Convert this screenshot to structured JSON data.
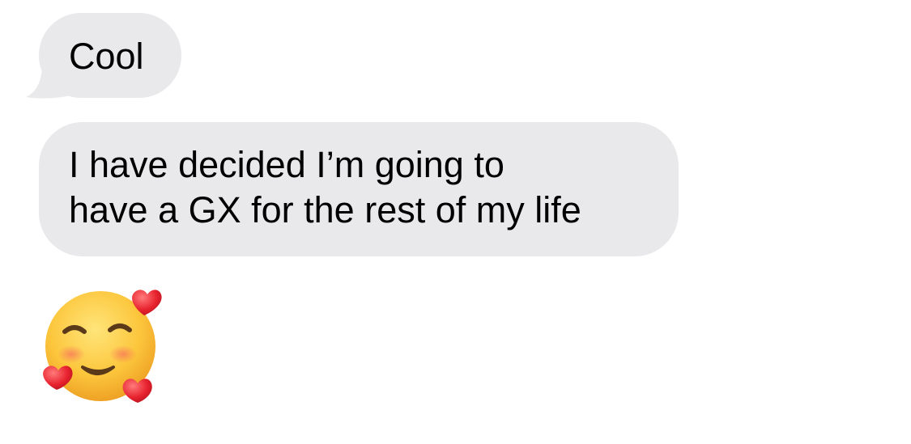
{
  "messages": [
    {
      "text": "Cool",
      "direction": "incoming"
    },
    {
      "lines": [
        "I have decided I’m going to",
        "have a GX for the rest of my life"
      ],
      "direction": "incoming"
    },
    {
      "emoji": "smiling-face-with-hearts",
      "direction": "incoming"
    }
  ],
  "colors": {
    "incoming_bubble": "#e9e9eb",
    "text": "#000000",
    "background": "#ffffff"
  }
}
